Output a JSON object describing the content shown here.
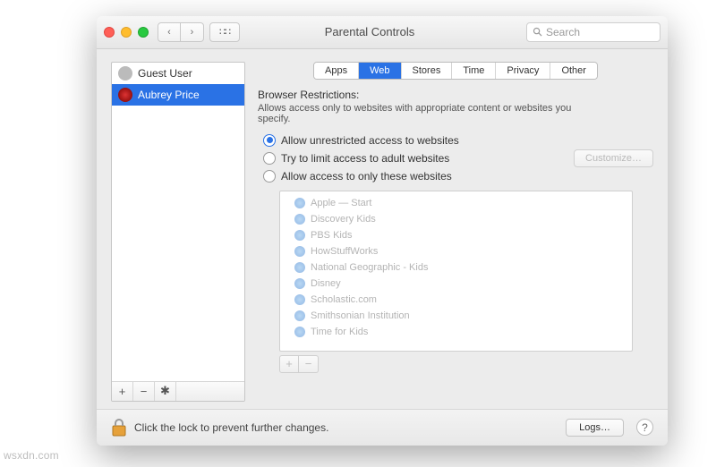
{
  "window": {
    "title": "Parental Controls"
  },
  "search": {
    "placeholder": "Search"
  },
  "sidebar": {
    "users": [
      {
        "name": "Guest User",
        "selected": false
      },
      {
        "name": "Aubrey Price",
        "selected": true
      }
    ],
    "tools": {
      "add": "+",
      "remove": "−",
      "menu": "✱"
    }
  },
  "tabs": [
    {
      "label": "Apps",
      "active": false
    },
    {
      "label": "Web",
      "active": true
    },
    {
      "label": "Stores",
      "active": false
    },
    {
      "label": "Time",
      "active": false
    },
    {
      "label": "Privacy",
      "active": false
    },
    {
      "label": "Other",
      "active": false
    }
  ],
  "browser_restrictions": {
    "title": "Browser Restrictions:",
    "description": "Allows access only to websites with appropriate content or websites you specify.",
    "options": [
      {
        "label": "Allow unrestricted access to websites",
        "selected": true
      },
      {
        "label": "Try to limit access to adult websites",
        "selected": false
      },
      {
        "label": "Allow access to only these websites",
        "selected": false
      }
    ],
    "customize_label": "Customize…",
    "allowed_sites": [
      "Apple — Start",
      "Discovery Kids",
      "PBS Kids",
      "HowStuffWorks",
      "National Geographic - Kids",
      "Disney",
      "Scholastic.com",
      "Smithsonian Institution",
      "Time for Kids"
    ],
    "add": "+",
    "remove": "−"
  },
  "footer": {
    "lock_message": "Click the lock to prevent further changes.",
    "logs_label": "Logs…",
    "help": "?"
  },
  "watermark": "wsxdn.com"
}
